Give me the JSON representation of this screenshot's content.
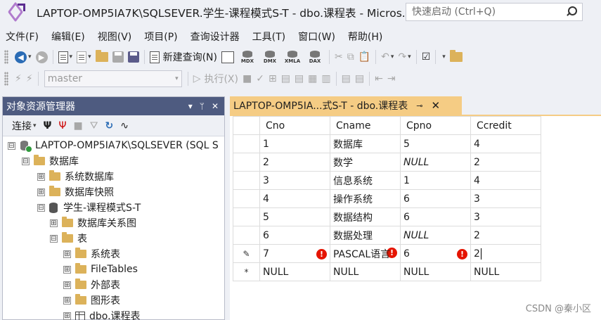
{
  "window": {
    "title": "LAPTOP-OMP5IA7K\\SQLSEVER.学生-课程模式S-T - dbo.课程表 - Micros...",
    "quick_launch_placeholder": "快速启动 (Ctrl+Q)"
  },
  "menu": [
    "文件(F)",
    "编辑(E)",
    "视图(V)",
    "项目(P)",
    "查询设计器",
    "工具(T)",
    "窗口(W)",
    "帮助(H)"
  ],
  "toolbar1": {
    "new_query": "新建查询(N)",
    "mini_icons": [
      "MDX",
      "DMX",
      "XMLA",
      "DAX"
    ]
  },
  "toolbar2": {
    "database_dropdown": "master",
    "execute": "执行(X)"
  },
  "object_explorer": {
    "title": "对象资源管理器",
    "pin": "▾ ᛘ ✕",
    "connect_label": "连接",
    "tree": [
      {
        "label": "LAPTOP-OMP5IA7K\\SQLSEVER (SQL S",
        "expander": "⊟"
      },
      {
        "label": "数据库",
        "expander": "⊟"
      },
      {
        "label": "系统数据库",
        "expander": "⊞"
      },
      {
        "label": "数据库快照",
        "expander": "⊞"
      },
      {
        "label": "学生-课程模式S-T",
        "expander": "⊟"
      },
      {
        "label": "数据库关系图",
        "expander": "⊞"
      },
      {
        "label": "表",
        "expander": "⊟"
      },
      {
        "label": "系统表",
        "expander": "⊞"
      },
      {
        "label": "FileTables",
        "expander": "⊞"
      },
      {
        "label": "外部表",
        "expander": "⊞"
      },
      {
        "label": "图形表",
        "expander": "⊞"
      },
      {
        "label": "dbo.课程表",
        "expander": "⊞"
      }
    ]
  },
  "document_tab": {
    "label": "LAPTOP-OMP5IA...式S-T - dbo.课程表",
    "pin_glyph": "⊸",
    "close_glyph": "✕"
  },
  "grid": {
    "columns": [
      "Cno",
      "Cname",
      "Cpno",
      "Ccredit"
    ],
    "rows": [
      {
        "marker": "",
        "cells": [
          "1",
          "数据库",
          "5",
          "4"
        ]
      },
      {
        "marker": "",
        "cells": [
          "2",
          "数学",
          "NULL",
          "2"
        ]
      },
      {
        "marker": "",
        "cells": [
          "3",
          "信息系统",
          "1",
          "4"
        ]
      },
      {
        "marker": "",
        "cells": [
          "4",
          "操作系统",
          "6",
          "3"
        ]
      },
      {
        "marker": "",
        "cells": [
          "5",
          "数据结构",
          "6",
          "3"
        ]
      },
      {
        "marker": "",
        "cells": [
          "6",
          "数据处理",
          "NULL",
          "2"
        ]
      },
      {
        "marker": "✎",
        "cells": [
          "7",
          "PASCAL语言",
          "6",
          "2"
        ]
      },
      {
        "marker": "*",
        "cells": [
          "NULL",
          "NULL",
          "NULL",
          "NULL"
        ]
      }
    ],
    "error_glyph": "!"
  },
  "watermark": "CSDN @秦小区"
}
